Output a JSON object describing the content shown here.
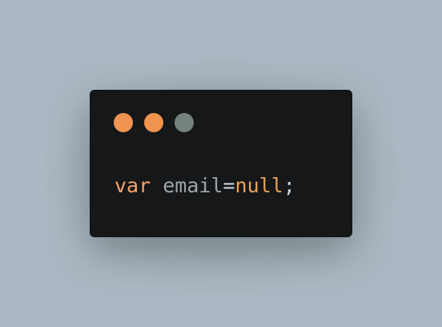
{
  "window": {
    "controls": [
      {
        "name": "close",
        "color": "#f0944f"
      },
      {
        "name": "minimize",
        "color": "#f0944f"
      },
      {
        "name": "maximize",
        "color": "#76827c"
      }
    ]
  },
  "code": {
    "keyword": "var",
    "space": " ",
    "identifier": "email",
    "operator": "=",
    "value": "null",
    "terminator": ";"
  },
  "colors": {
    "background": "#abb8c3",
    "window_background": "#151718",
    "keyword": "#f5a46a",
    "identifier": "#9aa5ac",
    "operator": "#ced6dc",
    "value": "#e8a35c",
    "terminator": "#ced6dc"
  }
}
